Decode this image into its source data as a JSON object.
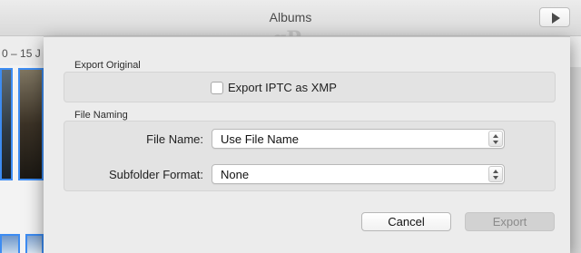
{
  "window": {
    "title": "Albums",
    "watermark": "gP",
    "date_range": "0 – 15 J"
  },
  "sheet": {
    "export_original": {
      "heading": "Export Original",
      "checkbox_label": "Export IPTC as XMP",
      "checked": false
    },
    "file_naming": {
      "heading": "File Naming",
      "file_name_label": "File Name:",
      "file_name_value": "Use File Name",
      "subfolder_label": "Subfolder Format:",
      "subfolder_value": "None"
    },
    "buttons": {
      "cancel": "Cancel",
      "export": "Export"
    }
  }
}
